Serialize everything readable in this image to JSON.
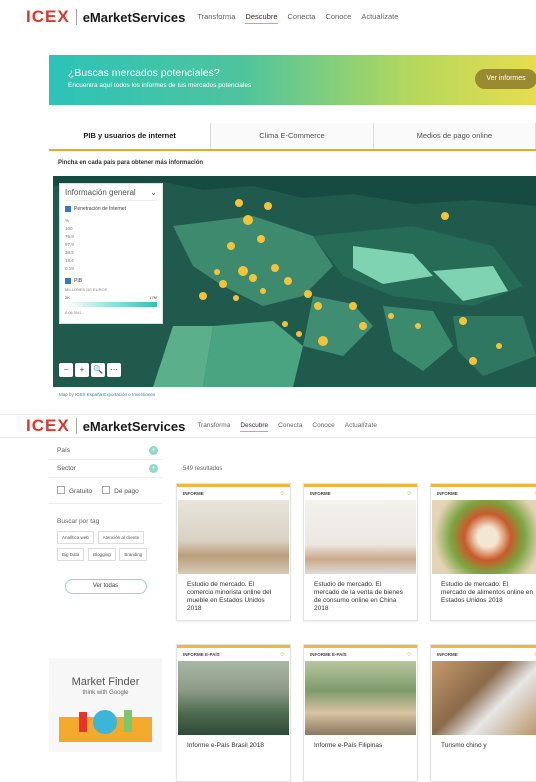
{
  "nav": {
    "logo_icex": "ICEX",
    "logo_ems": "eMarketServices",
    "links": [
      "Transforma",
      "Descubre",
      "Conecta",
      "Conoce",
      "Actualízate"
    ]
  },
  "banner": {
    "title": "¿Buscas mercados potenciales?",
    "subtitle": "Encuentra aquí todos los informes de tus mercados potenciales",
    "button": "Ver informes"
  },
  "tabs": [
    "PIB y usuarios de internet",
    "Clima E-Commerce",
    "Medios de pago online"
  ],
  "hint": "Pincha en cada país para obtener más información",
  "info_panel": {
    "title": "Información general",
    "penetration_label": "Penetración de Internet",
    "scale": [
      "%",
      "100",
      "76.9",
      "57.9",
      "38.5",
      "19.6",
      "0.19"
    ],
    "pib_label": "PIB",
    "pib_sub": "MILLONES DE EUROS",
    "pib_min": "2K",
    "pib_max": "17M",
    "pib_note": "0.06 5M1"
  },
  "map_tools": [
    "−",
    "+",
    "🔍",
    "⋯"
  ],
  "map_footer": {
    "prefix": "Map by",
    "credit": "ICEX España Exportación e Inversiones"
  },
  "side": {
    "filters": [
      "País",
      "Sector"
    ],
    "price": [
      "Gratuito",
      "De pago"
    ],
    "tag_label": "Buscar por tag",
    "tags": [
      "Analítica web",
      "Atención al cliente",
      "Big Data",
      "Blogging",
      "Branding"
    ],
    "see_all": "Ver todas",
    "mf_title": "Market Finder",
    "mf_sub": "think with Google"
  },
  "results": "549 resultados",
  "cards": [
    {
      "type": "INFORME",
      "title": "Estudio de mercado. El comercio minorista online del mueble en Estados Unidos 2018"
    },
    {
      "type": "INFORME",
      "title": "Estudio de mercado. El mercado de la venta de bienes de consumo online en China 2018"
    },
    {
      "type": "INFORME",
      "title": "Estudio de mercado. El mercado de alimentos online en Estados Unidos 2018"
    },
    {
      "type": "INFORME E-PAÍS",
      "title": "Informe e-País Brasil 2018"
    },
    {
      "type": "INFORME E-PAÍS",
      "title": "Informe e-País Filipinas"
    },
    {
      "type": "INFORME",
      "title": "Turismo chino y"
    }
  ],
  "colors": {
    "accent": "#e8a825",
    "brand_red": "#e8332a",
    "teal": "#2b6a5a",
    "bubble": "#f3c33a"
  }
}
